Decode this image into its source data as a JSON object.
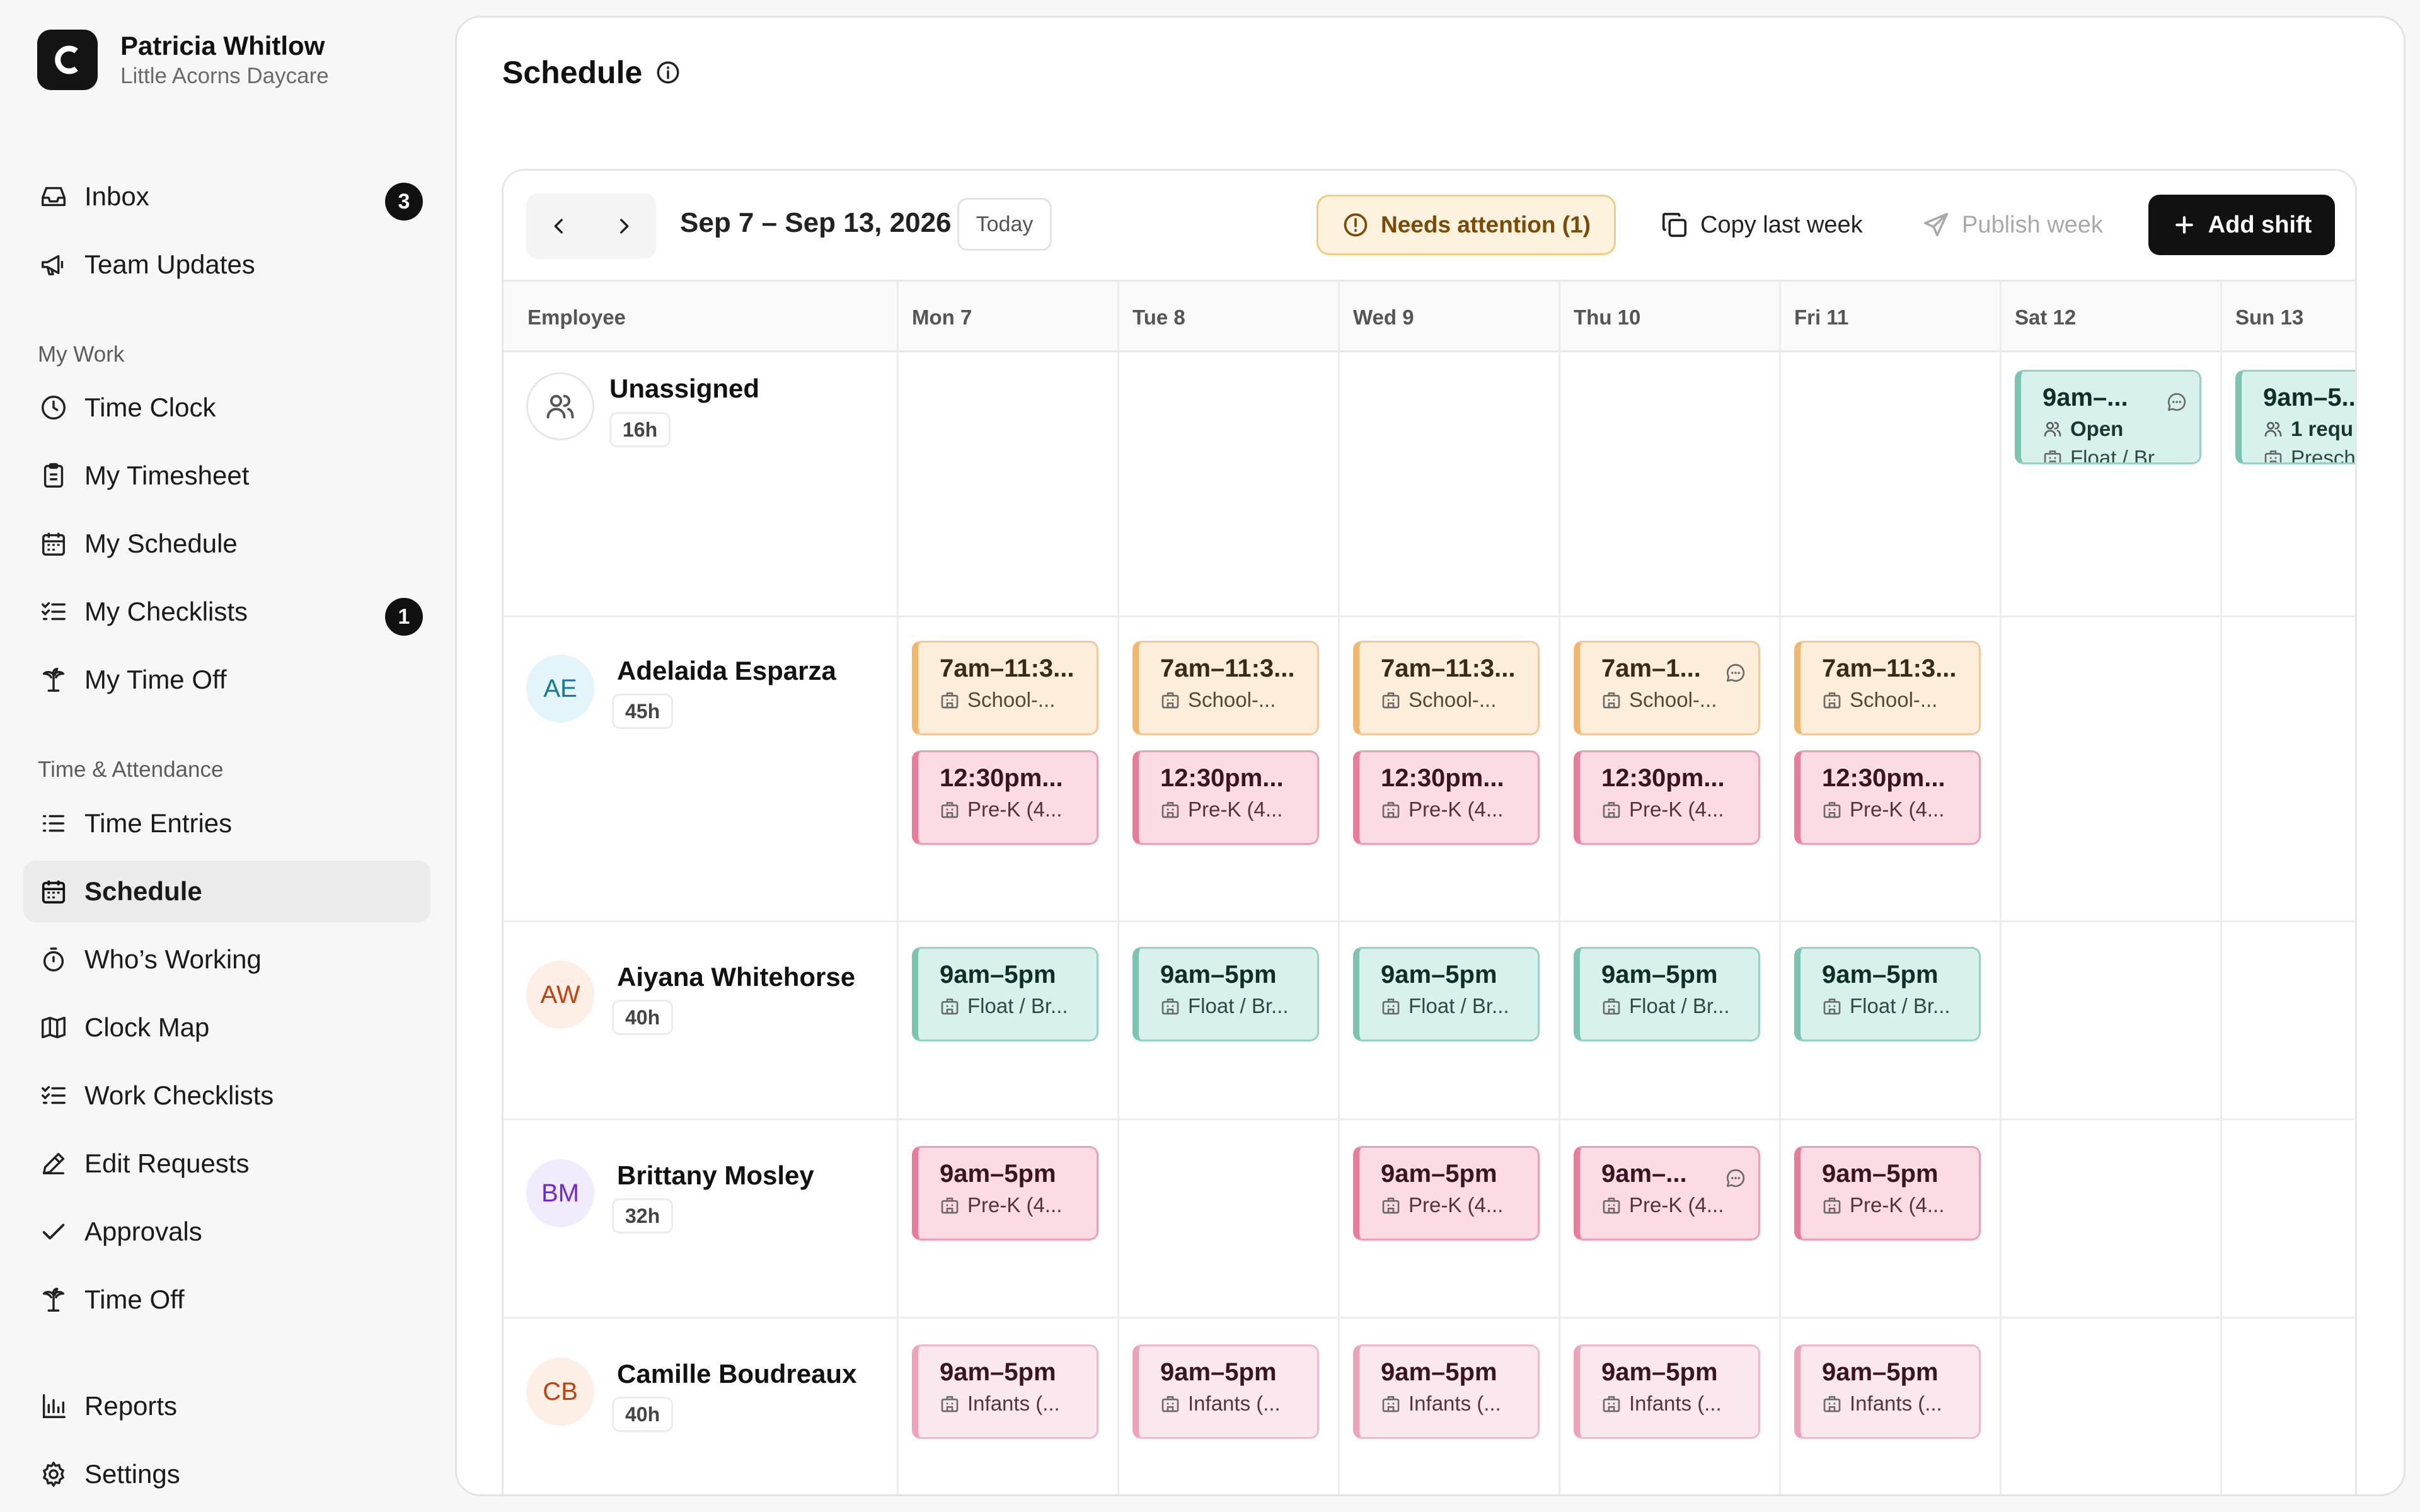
{
  "user": {
    "name": "Patricia Whitlow",
    "org": "Little Acorns Daycare"
  },
  "nav": {
    "inbox": {
      "label": "Inbox",
      "badge": "3"
    },
    "team_updates": {
      "label": "Team Updates"
    },
    "section_my_work": "My Work",
    "time_clock": {
      "label": "Time Clock"
    },
    "my_timesheet": {
      "label": "My Timesheet"
    },
    "my_schedule": {
      "label": "My Schedule"
    },
    "my_checklists": {
      "label": "My Checklists",
      "badge": "1"
    },
    "my_time_off": {
      "label": "My Time Off"
    },
    "section_time_attendance": "Time & Attendance",
    "time_entries": {
      "label": "Time Entries"
    },
    "schedule": {
      "label": "Schedule"
    },
    "whos_working": {
      "label": "Who’s Working"
    },
    "clock_map": {
      "label": "Clock Map"
    },
    "work_checklists": {
      "label": "Work Checklists"
    },
    "edit_requests": {
      "label": "Edit Requests"
    },
    "approvals": {
      "label": "Approvals"
    },
    "time_off": {
      "label": "Time Off"
    },
    "reports": {
      "label": "Reports"
    },
    "settings": {
      "label": "Settings"
    }
  },
  "page": {
    "title": "Schedule"
  },
  "toolbar": {
    "date_range": "Sep 7 – Sep 13, 2026",
    "today": "Today",
    "needs_attention": "Needs attention (1)",
    "copy_last_week": "Copy last week",
    "publish_week": "Publish week",
    "add_shift": "Add shift"
  },
  "grid": {
    "employee_col": "Employee",
    "days": [
      "Mon 7",
      "Tue 8",
      "Wed 9",
      "Thu 10",
      "Fri 11",
      "Sat 12",
      "Sun 13"
    ]
  },
  "employees": [
    {
      "name": "Unassigned",
      "hours": "16h",
      "initials": "",
      "shifts": [
        {
          "day": 5,
          "slot": 0,
          "color": "teal",
          "time": "9am–...",
          "sub1": "Open",
          "sub2": "Float / Br...",
          "message": true
        },
        {
          "day": 6,
          "slot": 0,
          "color": "teal",
          "time": "9am–5...",
          "sub1": "1 requ",
          "sub2": "Presch",
          "message": false
        }
      ]
    },
    {
      "name": "Adelaida Esparza",
      "hours": "45h",
      "initials": "AE",
      "avatar_bg": "#e3f4fb",
      "avatar_fg": "#147a9a",
      "shifts": [
        {
          "day": 0,
          "slot": 0,
          "color": "orange",
          "time": "7am–11:3...",
          "sub2": "School-..."
        },
        {
          "day": 1,
          "slot": 0,
          "color": "orange",
          "time": "7am–11:3...",
          "sub2": "School-..."
        },
        {
          "day": 2,
          "slot": 0,
          "color": "orange",
          "time": "7am–11:3...",
          "sub2": "School-..."
        },
        {
          "day": 3,
          "slot": 0,
          "color": "orange",
          "time": "7am–1...",
          "sub2": "School-...",
          "message": true
        },
        {
          "day": 4,
          "slot": 0,
          "color": "orange",
          "time": "7am–11:3...",
          "sub2": "School-..."
        },
        {
          "day": 0,
          "slot": 1,
          "color": "pink",
          "time": "12:30pm...",
          "sub2": "Pre-K (4..."
        },
        {
          "day": 1,
          "slot": 1,
          "color": "pink",
          "time": "12:30pm...",
          "sub2": "Pre-K (4..."
        },
        {
          "day": 2,
          "slot": 1,
          "color": "pink",
          "time": "12:30pm...",
          "sub2": "Pre-K (4..."
        },
        {
          "day": 3,
          "slot": 1,
          "color": "pink",
          "time": "12:30pm...",
          "sub2": "Pre-K (4..."
        },
        {
          "day": 4,
          "slot": 1,
          "color": "pink",
          "time": "12:30pm...",
          "sub2": "Pre-K (4..."
        }
      ]
    },
    {
      "name": "Aiyana Whitehorse",
      "hours": "40h",
      "initials": "AW",
      "avatar_bg": "#fdeee6",
      "avatar_fg": "#c2410c",
      "shifts": [
        {
          "day": 0,
          "slot": 0,
          "color": "teal",
          "time": "9am–5pm",
          "sub2": "Float / Br..."
        },
        {
          "day": 1,
          "slot": 0,
          "color": "teal",
          "time": "9am–5pm",
          "sub2": "Float / Br..."
        },
        {
          "day": 2,
          "slot": 0,
          "color": "teal",
          "time": "9am–5pm",
          "sub2": "Float / Br..."
        },
        {
          "day": 3,
          "slot": 0,
          "color": "teal",
          "time": "9am–5pm",
          "sub2": "Float / Br..."
        },
        {
          "day": 4,
          "slot": 0,
          "color": "teal",
          "time": "9am–5pm",
          "sub2": "Float / Br..."
        }
      ]
    },
    {
      "name": "Brittany Mosley",
      "hours": "32h",
      "initials": "BM",
      "avatar_bg": "#f1ecfd",
      "avatar_fg": "#6d28d9",
      "shifts": [
        {
          "day": 0,
          "slot": 0,
          "color": "pink",
          "time": "9am–5pm",
          "sub2": "Pre-K (4..."
        },
        {
          "day": 2,
          "slot": 0,
          "color": "pink",
          "time": "9am–5pm",
          "sub2": "Pre-K (4..."
        },
        {
          "day": 3,
          "slot": 0,
          "color": "pink",
          "time": "9am–...",
          "sub2": "Pre-K (4...",
          "message": true
        },
        {
          "day": 4,
          "slot": 0,
          "color": "pink",
          "time": "9am–5pm",
          "sub2": "Pre-K (4..."
        }
      ]
    },
    {
      "name": "Camille Boudreaux",
      "hours": "40h",
      "initials": "CB",
      "avatar_bg": "#fdeee6",
      "avatar_fg": "#c2410c",
      "shifts": [
        {
          "day": 0,
          "slot": 0,
          "color": "lightpink",
          "time": "9am–5pm",
          "sub2": "Infants (..."
        },
        {
          "day": 1,
          "slot": 0,
          "color": "lightpink",
          "time": "9am–5pm",
          "sub2": "Infants (..."
        },
        {
          "day": 2,
          "slot": 0,
          "color": "lightpink",
          "time": "9am–5pm",
          "sub2": "Infants (..."
        },
        {
          "day": 3,
          "slot": 0,
          "color": "lightpink",
          "time": "9am–5pm",
          "sub2": "Infants (..."
        },
        {
          "day": 4,
          "slot": 0,
          "color": "lightpink",
          "time": "9am–5pm",
          "sub2": "Infants (..."
        }
      ]
    }
  ]
}
